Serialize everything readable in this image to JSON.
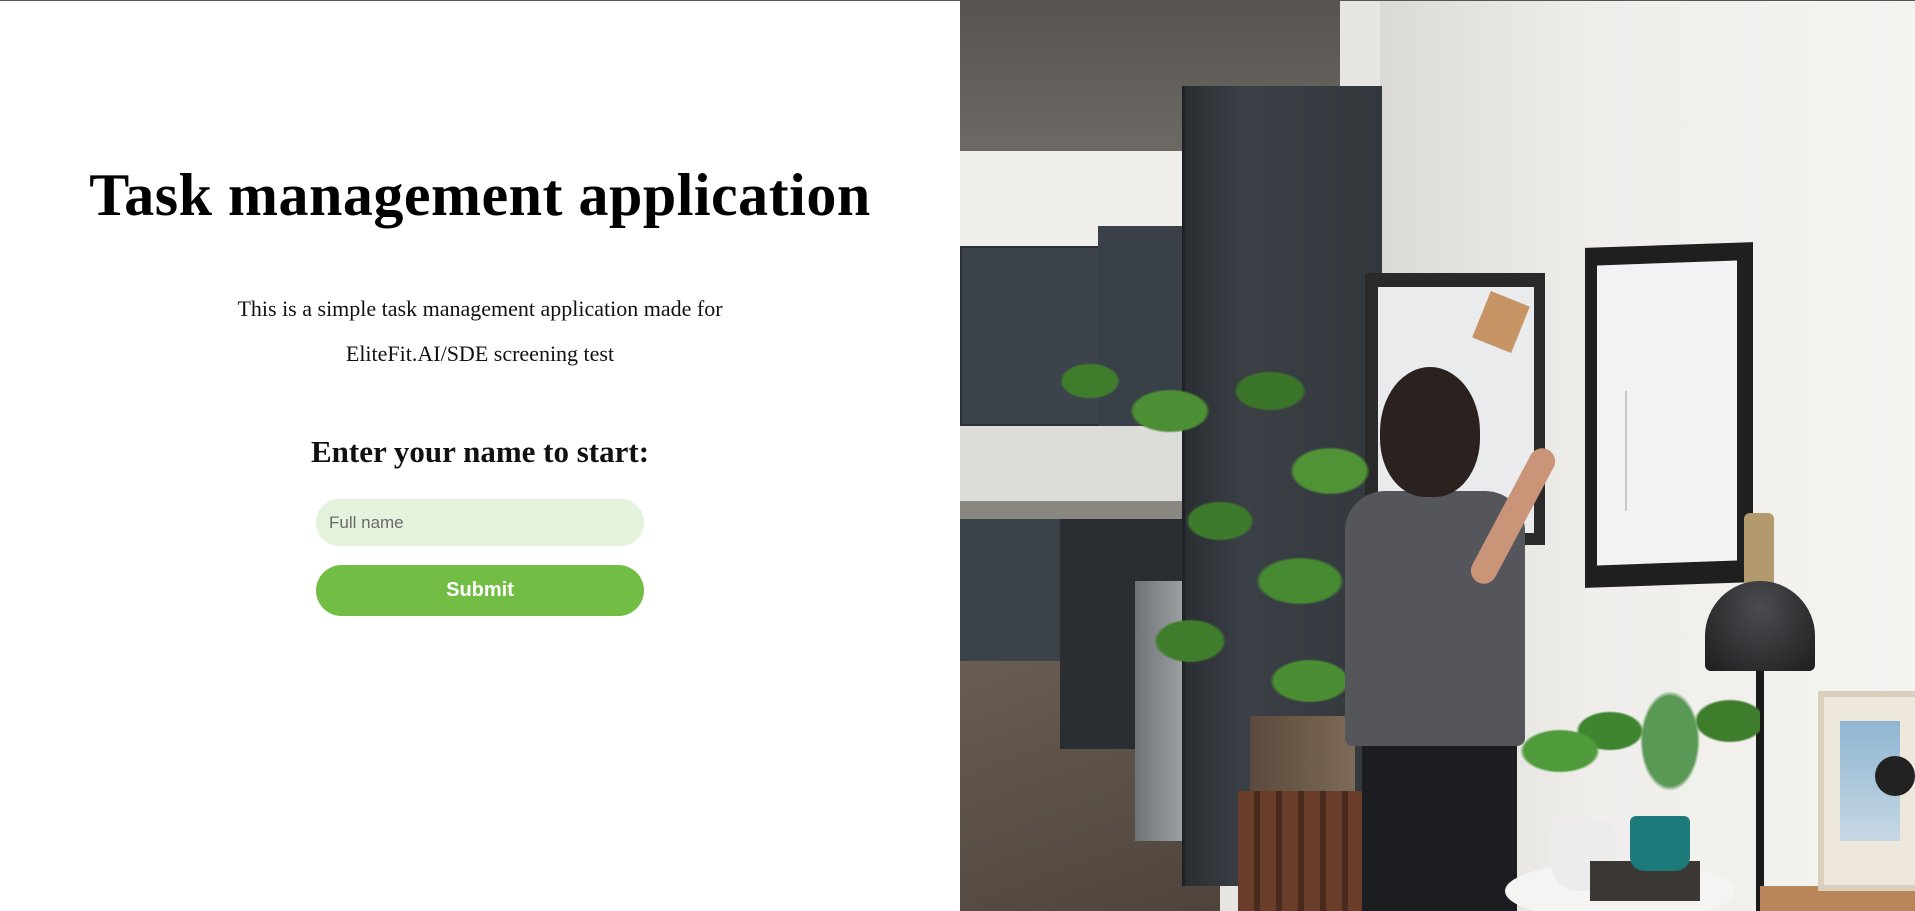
{
  "app": {
    "title": "Task management application",
    "description": "This is a simple task management application made for EliteFit.AI/SDE screening test"
  },
  "form": {
    "prompt": "Enter your name to start:",
    "name_placeholder": "Full name",
    "name_value": "",
    "submit_label": "Submit"
  },
  "colors": {
    "accent": "#72bd44",
    "input_background": "#e5f2dc"
  },
  "hero_image": {
    "icon": "photo-woman-writing-on-whiteboard"
  }
}
